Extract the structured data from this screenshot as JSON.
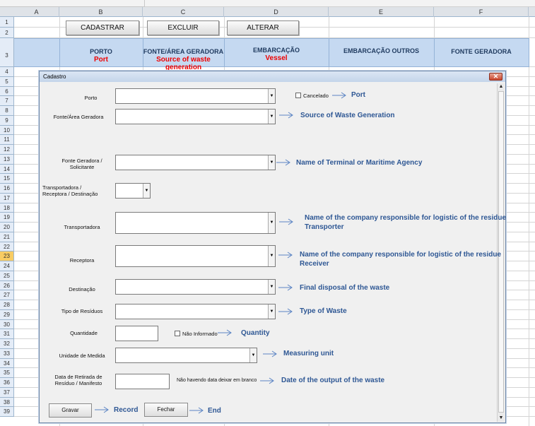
{
  "columns": [
    "A",
    "B",
    "C",
    "D",
    "E",
    "F"
  ],
  "rows": [
    "1",
    "2",
    "3",
    "4",
    "5",
    "6",
    "7",
    "8",
    "9",
    "10",
    "11",
    "12",
    "13",
    "14",
    "15",
    "16",
    "17",
    "18",
    "19",
    "20",
    "21",
    "22",
    "23",
    "24",
    "25",
    "26",
    "27",
    "28",
    "29",
    "30",
    "31",
    "32",
    "33",
    "34",
    "35",
    "36",
    "37",
    "38",
    "39"
  ],
  "toolbar": {
    "cadastrar": "CADASTRAR",
    "excluir": "EXCLUIR",
    "alterar": "ALTERAR"
  },
  "header": {
    "porto": "PORTO",
    "porto_en": "Port",
    "fonte": "FONTE/ÁREA GERADORA",
    "fonte_en_1": "Source of waste",
    "fonte_en_2": "generation",
    "embarcacao": "EMBARCAÇÃO",
    "embarcacao_en": "Vessel",
    "embarcacao_outros": "EMBARCAÇÃO OUTROS",
    "fonte_geradora": "FONTE GERADORA"
  },
  "dialog": {
    "title": "Cadastro",
    "close": "✕",
    "labels": {
      "porto": "Porto",
      "fonte_area": "Fonte/Área Geradora",
      "fonte_solicitante_1": "Fonte Geradora  /",
      "fonte_solicitante_2": "Solicitante",
      "transp_rec_dest_1": "Transportadora /",
      "transp_rec_dest_2": "Receptora / Destinação",
      "transportadora": "Transportadora",
      "receptora": "Receptora",
      "destinacao": "Destinação",
      "tipo_residuos": "Tipo de Resíduos",
      "quantidade": "Quantidade",
      "unidade": "Unidade de Medida",
      "data_1": "Data de Retirada de",
      "data_2": "Resíduo / Manifesto"
    },
    "cancelado": "Cancelado",
    "nao_informado": "Não Informado",
    "note_data": "Não havendo data deixar em branco",
    "gravar": "Gravar",
    "fechar": "Fechar"
  },
  "annotations": {
    "port": "Port",
    "source": "Source of Waste Generation",
    "terminal": "Name of Terminal or Maritime Agency",
    "transporter_1": "Name of the company responsible for logistic of the residue",
    "transporter_2": "Transporter",
    "receiver_1": "Name of the company responsible for logistic of the residue",
    "receiver_2": "Receiver",
    "final": "Final disposal of the waste",
    "type": "Type of Waste",
    "quantity": "Quantity",
    "unit": "Measuring unit",
    "date": "Date of the output of the waste",
    "record": "Record",
    "end": "End"
  },
  "colors": {
    "annotation": "#2e5794",
    "header_band": "#c5d9f1",
    "red_label": "#e00000"
  }
}
